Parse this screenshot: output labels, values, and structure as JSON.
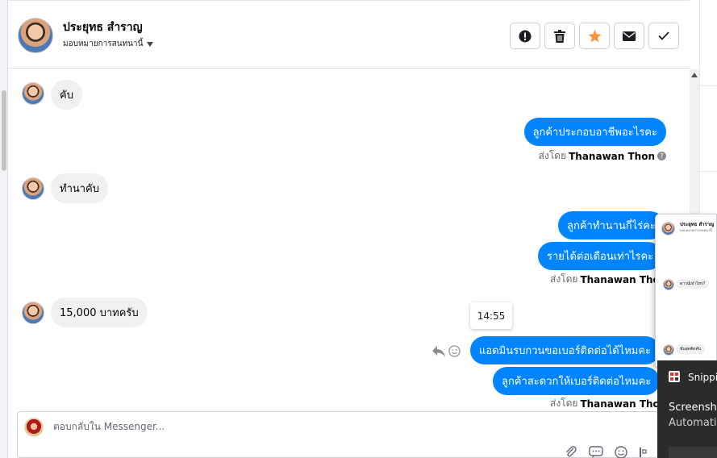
{
  "header": {
    "contact_name": "ประยุทธ สำราญ",
    "assign_label": "มอบหมายการสนทนานี้",
    "actions": [
      {
        "name": "report-button",
        "icon": "exclamation-icon"
      },
      {
        "name": "delete-button",
        "icon": "trash-icon"
      },
      {
        "name": "star-button",
        "icon": "star-icon"
      },
      {
        "name": "mark-unread-button",
        "icon": "envelope-icon"
      },
      {
        "name": "done-button",
        "icon": "checkmark-icon"
      }
    ]
  },
  "messages": {
    "in_1": "คับ",
    "out_1": "ลูกค้าประกอบอาชีพอะไรคะ",
    "sent_by_1_prefix": "ส่งโดย",
    "sent_by_1_name": "Thanawan Thon",
    "in_2": "ทำนาคับ",
    "out_2": "ลูกค้าทำนานกี่ไร่คะ",
    "out_3": "รายได้ต่อเดือนเท่าไรคะ",
    "sent_by_2_prefix": "ส่งโดย",
    "sent_by_2_name": "Thanawan Thon",
    "in_3": "15,000 บาทครับ",
    "out_4": "แอดมินรบกวนขอเบอร์ติดต่อได้ไหมคะ",
    "out_5": "ลูกค้าสะดวกให้เบอร์ติดต่อไหมคะ",
    "sent_by_3_prefix": "ส่งโดย",
    "sent_by_3_name": "Thanawan Thon"
  },
  "tooltip_time": "14:55",
  "composer": {
    "placeholder": "ตอบกลับใน Messenger..."
  },
  "popup": {
    "name": "ประยุทธ สำราญ",
    "sub": "มอบหมายการสนทนานี้",
    "msg_1": "ดาวน์เท่าไหร่?",
    "msg_2": "ขับสุดคิดคับ"
  },
  "snipping": {
    "app_name": "Snipping Tool",
    "title": "Screenshot copied",
    "desc": "Automatically saved"
  },
  "colors": {
    "accent": "#0084ff",
    "star": "#f7923b"
  }
}
